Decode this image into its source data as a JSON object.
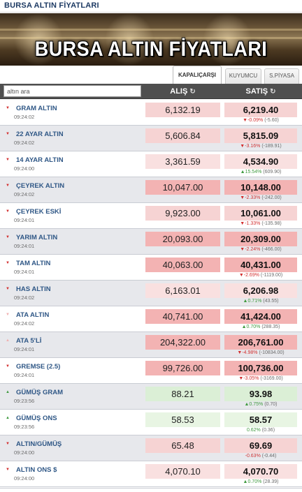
{
  "topbar": {
    "title": "BURSA ALTIN FİYATLARI"
  },
  "banner": {
    "title": "BURSA ALTIN FİYATLARI"
  },
  "tabs": [
    {
      "label": "KAPALIÇARŞI",
      "active": true
    },
    {
      "label": "KUYUMCU",
      "active": false
    },
    {
      "label": "S.PİYASA",
      "active": false
    }
  ],
  "header": {
    "search_placeholder": "altın ara",
    "alis_label": "ALIŞ",
    "satis_label": "SATIŞ",
    "sort_icon": "sort-icon"
  },
  "colors": {
    "down": "#d32f2f",
    "up": "#3f9a3f",
    "name": "#2f5786",
    "header_bg": "#4f4f4f"
  },
  "rows": [
    {
      "name": "GRAM ALTIN",
      "time": "09:24:02",
      "alis": "6,132.19",
      "satis": "6,219.40",
      "dir": "down",
      "pct": "-0.09%",
      "abs": "(-5.60)",
      "chg_arrow": "▼",
      "tri": "▼",
      "tri_color": "#d32f2f",
      "alis_bg": "bg-red1",
      "satis_bg": "bg-red1"
    },
    {
      "name": "22 AYAR ALTIN",
      "time": "09:24:02",
      "alis": "5,606.84",
      "satis": "5,815.09",
      "dir": "down",
      "pct": "-3.16%",
      "abs": "(-189.91)",
      "chg_arrow": "▼",
      "tri": "▼",
      "tri_color": "#d32f2f",
      "alis_bg": "bg-red1",
      "satis_bg": "bg-red1"
    },
    {
      "name": "14 AYAR ALTIN",
      "time": "09:24:00",
      "alis": "3,361.59",
      "satis": "4,534.90",
      "dir": "up",
      "pct": "15.54%",
      "abs": "(609.90)",
      "chg_arrow": "▲",
      "tri": "▼",
      "tri_color": "#d32f2f",
      "alis_bg": "bg-red3",
      "satis_bg": "bg-red3"
    },
    {
      "name": "ÇEYREK ALTIN",
      "time": "09:24:02",
      "alis": "10,047.00",
      "satis": "10,148.00",
      "dir": "down",
      "pct": "-2.33%",
      "abs": "(-242.00)",
      "chg_arrow": "▼",
      "tri": "▼",
      "tri_color": "#d32f2f",
      "alis_bg": "bg-red2",
      "satis_bg": "bg-red2"
    },
    {
      "name": "ÇEYREK ESKİ",
      "time": "09:24:01",
      "alis": "9,923.00",
      "satis": "10,061.00",
      "dir": "down",
      "pct": "-1.33%",
      "abs": "(-135.98)",
      "chg_arrow": "▼",
      "tri": "▼",
      "tri_color": "#d32f2f",
      "alis_bg": "bg-red1",
      "satis_bg": "bg-red1"
    },
    {
      "name": "YARIM ALTIN",
      "time": "09:24:01",
      "alis": "20,093.00",
      "satis": "20,309.00",
      "dir": "down",
      "pct": "-2.24%",
      "abs": "(-466.00)",
      "chg_arrow": "▼",
      "tri": "▼",
      "tri_color": "#d32f2f",
      "alis_bg": "bg-red2",
      "satis_bg": "bg-red2"
    },
    {
      "name": "TAM ALTIN",
      "time": "09:24:01",
      "alis": "40,063.00",
      "satis": "40,431.00",
      "dir": "down",
      "pct": "-2.69%",
      "abs": "(-1119.00)",
      "chg_arrow": "▼",
      "tri": "▼",
      "tri_color": "#d32f2f",
      "alis_bg": "bg-red2",
      "satis_bg": "bg-red2"
    },
    {
      "name": "HAS ALTIN",
      "time": "09:24:02",
      "alis": "6,163.01",
      "satis": "6,206.98",
      "dir": "up",
      "pct": "0.71%",
      "abs": "(43.55)",
      "chg_arrow": "▲",
      "tri": "▼",
      "tri_color": "#d32f2f",
      "alis_bg": "bg-red3",
      "satis_bg": "bg-red3"
    },
    {
      "name": "ATA ALTIN",
      "time": "09:24:02",
      "alis": "40,741.00",
      "satis": "41,424.00",
      "dir": "up",
      "pct": "0.70%",
      "abs": "(288.35)",
      "chg_arrow": "▲",
      "tri": "▼",
      "tri_color": "#f0b0b0",
      "alis_bg": "bg-red2",
      "satis_bg": "bg-red2"
    },
    {
      "name": "ATA 5'Lİ",
      "time": "09:24:01",
      "alis": "204,322.00",
      "satis": "206,761.00",
      "dir": "down",
      "pct": "-4.98%",
      "abs": "(-10834.00)",
      "chg_arrow": "▼",
      "tri": "▲",
      "tri_color": "#f0b0b0",
      "alis_bg": "bg-red2",
      "satis_bg": "bg-red2"
    },
    {
      "name": "GREMSE (2.5)",
      "time": "09:24:01",
      "alis": "99,726.00",
      "satis": "100,736.00",
      "dir": "down",
      "pct": "-3.05%",
      "abs": "(-3169.00)",
      "chg_arrow": "▼",
      "tri": "▼",
      "tri_color": "#d32f2f",
      "alis_bg": "bg-red2",
      "satis_bg": "bg-red2"
    },
    {
      "name": "GÜMÜŞ GRAM",
      "time": "09:23:56",
      "alis": "88.21",
      "satis": "93.98",
      "dir": "up",
      "pct": "0.75%",
      "abs": "(0.70)",
      "chg_arrow": "▲",
      "tri": "▲",
      "tri_color": "#3f9a3f",
      "alis_bg": "bg-green1",
      "satis_bg": "bg-green1"
    },
    {
      "name": "GÜMÜŞ ONS",
      "time": "09:23:56",
      "alis": "58.53",
      "satis": "58.57",
      "dir": "up",
      "pct": "0.62%",
      "abs": "(0.36)",
      "chg_arrow": "",
      "tri": "▲",
      "tri_color": "#3f9a3f",
      "alis_bg": "bg-green2",
      "satis_bg": "bg-green2"
    },
    {
      "name": "ALTIN/GÜMÜŞ",
      "time": "09:24:00",
      "alis": "65.48",
      "satis": "69.69",
      "dir": "down",
      "pct": "-0.63%",
      "abs": "(-0.44)",
      "chg_arrow": "",
      "tri": "▼",
      "tri_color": "#d32f2f",
      "alis_bg": "bg-red1",
      "satis_bg": "bg-red1"
    },
    {
      "name": "ALTIN ONS $",
      "time": "09:24:00",
      "alis": "4,070.10",
      "satis": "4,070.70",
      "dir": "up",
      "pct": "0.70%",
      "abs": "(28.39)",
      "chg_arrow": "▲",
      "tri": "▼",
      "tri_color": "#d32f2f",
      "alis_bg": "bg-red3",
      "satis_bg": "bg-red3"
    }
  ]
}
